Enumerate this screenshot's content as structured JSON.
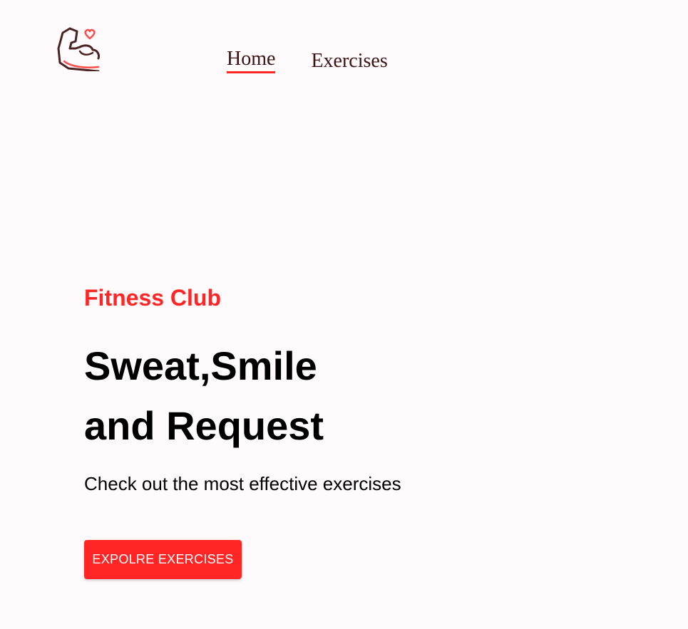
{
  "header": {
    "logo_icon": "flexing-arm-heart-icon",
    "nav": {
      "home": "Home",
      "exercises": "Exercises"
    }
  },
  "hero": {
    "kicker": "Fitness Club",
    "title_line1": "Sweat,Smile",
    "title_line2": "and Request",
    "subtitle": "Check out the most effective exercises",
    "cta_label": "EXPOLRE EXERCISES"
  },
  "colors": {
    "accent": "#FF2625",
    "nav_text": "#3A1212",
    "background": "#FFFAFB"
  }
}
